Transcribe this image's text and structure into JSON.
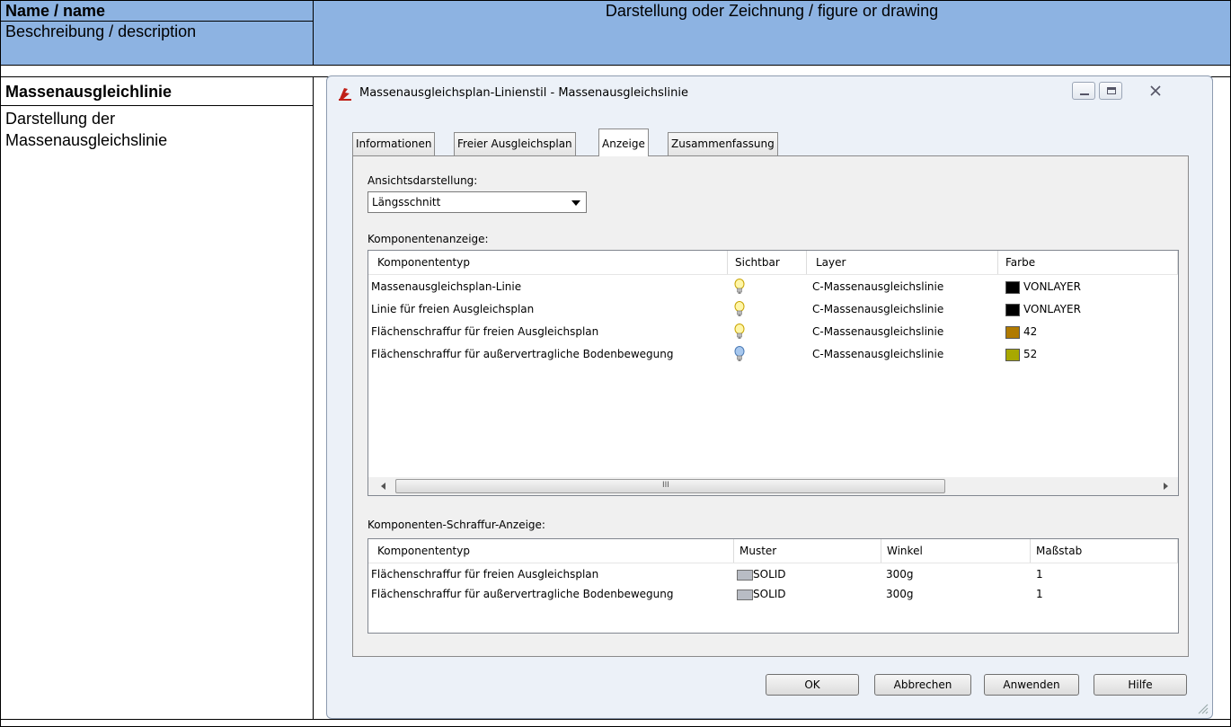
{
  "doc": {
    "header": {
      "name_label": "Name / name",
      "description_label": "Beschreibung / description",
      "figure_label": "Darstellung oder Zeichnung / figure or drawing"
    },
    "entry": {
      "name": "Massenausgleichlinie",
      "description_line1": "Darstellung der",
      "description_line2": "Massenausgleichslinie"
    }
  },
  "dialog": {
    "title": "Massenausgleichsplan-Linienstil - Massenausgleichslinie",
    "tabs": [
      {
        "label": "Informationen"
      },
      {
        "label": "Freier Ausgleichsplan"
      },
      {
        "label": "Anzeige"
      },
      {
        "label": "Zusammenfassung"
      }
    ],
    "view_label": "Ansichtsdarstellung:",
    "view_value": "Längsschnitt",
    "comp_label": "Komponentenanzeige:",
    "comp_columns": [
      "Komponententyp",
      "Sichtbar",
      "Layer",
      "Farbe"
    ],
    "comp_rows": [
      {
        "type": "Massenausgleichsplan-Linie",
        "visible": true,
        "layer": "C-Massenausgleichslinie",
        "color": "VONLAYER",
        "swatch": "#000000"
      },
      {
        "type": "Linie für freien Ausgleichsplan",
        "visible": true,
        "layer": "C-Massenausgleichslinie",
        "color": "VONLAYER",
        "swatch": "#000000"
      },
      {
        "type": "Flächenschraffur für freien Ausgleichsplan",
        "visible": true,
        "layer": "C-Massenausgleichslinie",
        "color": "42",
        "swatch": "#b07a00"
      },
      {
        "type": "Flächenschraffur für außervertragliche Bodenbewegung",
        "visible": false,
        "layer": "C-Massenausgleichslinie",
        "color": "52",
        "swatch": "#a8a800"
      }
    ],
    "scroll_mark": "III",
    "hatch_label": "Komponenten-Schraffur-Anzeige:",
    "hatch_columns": [
      "Komponententyp",
      "Muster",
      "Winkel",
      "Maßstab"
    ],
    "hatch_rows": [
      {
        "type": "Flächenschraffur für freien Ausgleichsplan",
        "pattern": "SOLID",
        "angle": "300g",
        "scale": "1"
      },
      {
        "type": "Flächenschraffur für außervertragliche Bodenbewegung",
        "pattern": "SOLID",
        "angle": "300g",
        "scale": "1"
      }
    ],
    "buttons": {
      "ok": "OK",
      "cancel": "Abbrechen",
      "apply": "Anwenden",
      "help": "Hilfe"
    },
    "colors": {
      "header_bg": "#8db3e2",
      "dialog_bg": "#ecf1f8"
    }
  }
}
